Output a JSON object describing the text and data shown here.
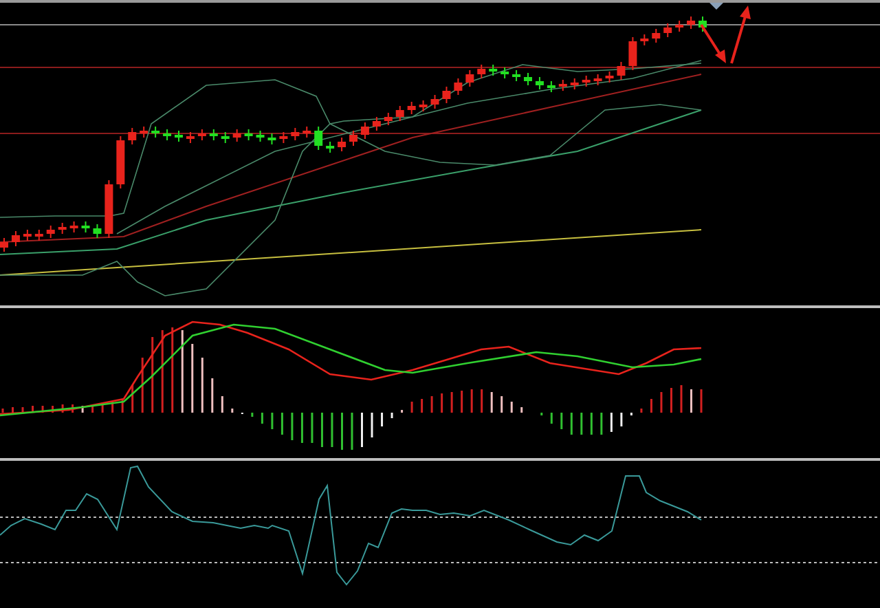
{
  "chart_panels": [
    {
      "kind": "candlestick"
    },
    {
      "kind": "macd"
    },
    {
      "kind": "oscillator"
    }
  ]
}
